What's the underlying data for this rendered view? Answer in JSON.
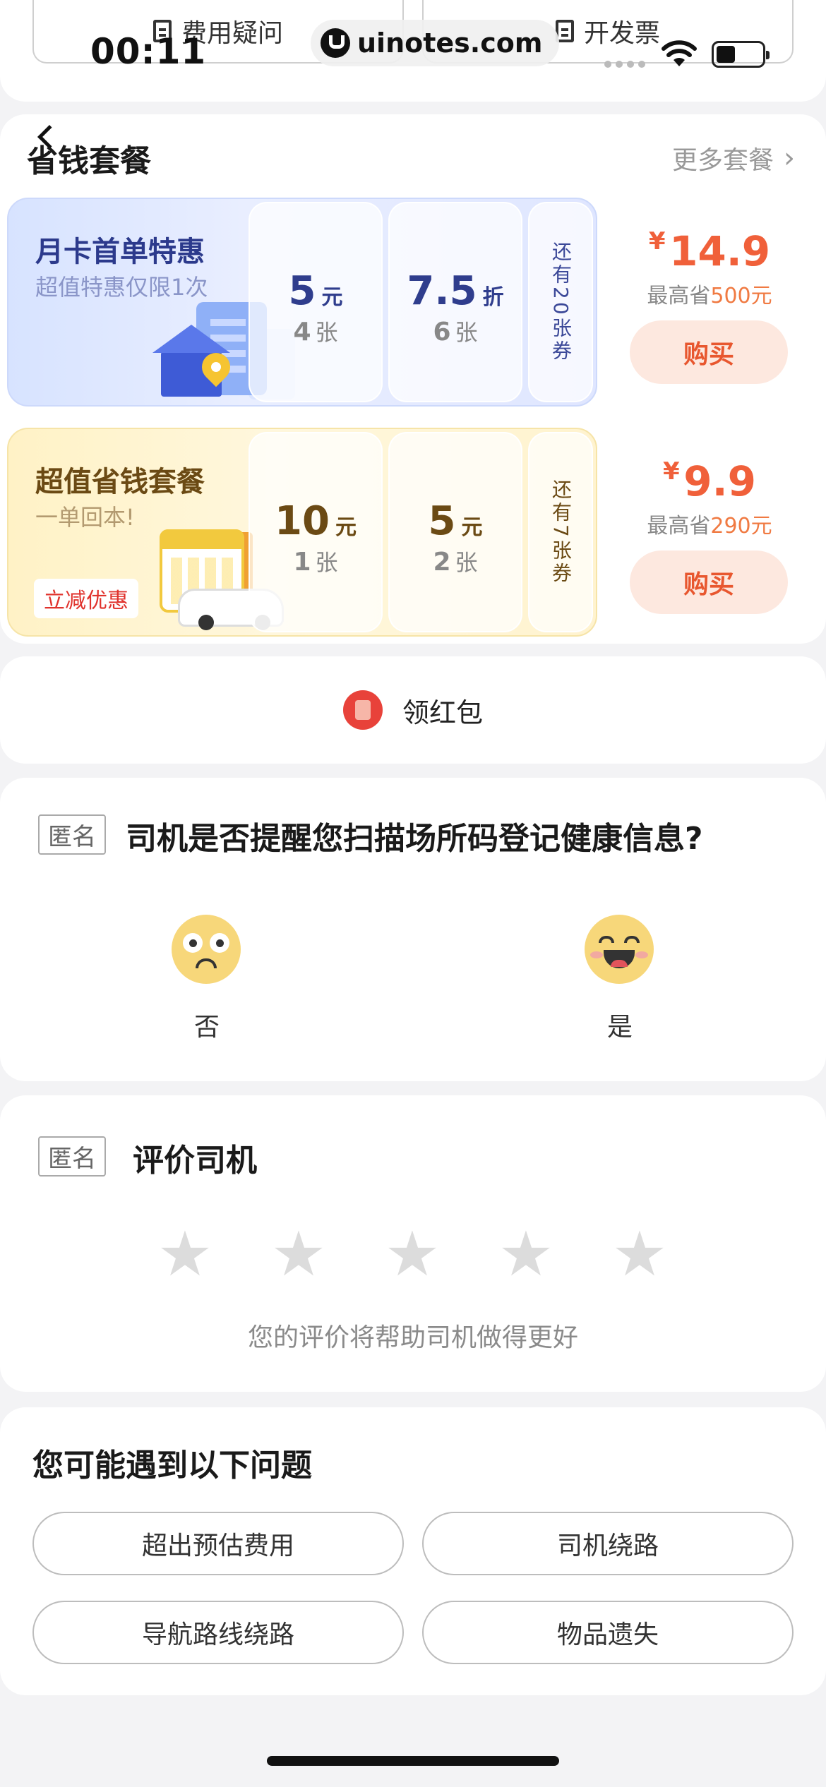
{
  "top": {
    "buttons": [
      "费用疑问",
      "开发票"
    ],
    "time": "00:11",
    "watermark": "uinotes.com"
  },
  "packages": {
    "title": "省钱套餐",
    "more": "更多套餐",
    "items": [
      {
        "title": "月卡首单特惠",
        "subtitle": "超值特惠仅限1次",
        "tag": "",
        "coupons": [
          {
            "value": "5",
            "unit": "元",
            "count": "4",
            "count_unit": "张"
          },
          {
            "value": "7.5",
            "unit": "折",
            "count": "6",
            "count_unit": "张"
          }
        ],
        "remaining": "还有20张券",
        "currency": "¥",
        "price": "14.9",
        "save_prefix": "最高省",
        "save_amount": "500元",
        "buy": "购买"
      },
      {
        "title": "超值省钱套餐",
        "subtitle": "一单回本!",
        "tag": "立减优惠",
        "coupons": [
          {
            "value": "10",
            "unit": "元",
            "count": "1",
            "count_unit": "张"
          },
          {
            "value": "5",
            "unit": "元",
            "count": "2",
            "count_unit": "张"
          }
        ],
        "remaining": "还有7张券",
        "currency": "¥",
        "price": "9.9",
        "save_prefix": "最高省",
        "save_amount": "290元",
        "buy": "购买"
      }
    ]
  },
  "red_packet": {
    "label": "领红包"
  },
  "survey": {
    "anonymous": "匿名",
    "question": "司机是否提醒您扫描场所码登记健康信息?",
    "options": [
      "否",
      "是"
    ]
  },
  "rating": {
    "anonymous": "匿名",
    "title": "评价司机",
    "stars": 5,
    "selected": 0,
    "hint": "您的评价将帮助司机做得更好"
  },
  "issues": {
    "title": "您可能遇到以下问题",
    "items": [
      "超出预估费用",
      "司机绕路",
      "导航路线绕路",
      "物品遗失"
    ]
  },
  "colors": {
    "accent_orange": "#f0603a",
    "buy_bg": "#fde8df",
    "blue_card": "#d7e3ff",
    "yellow_card": "#fff2c6"
  }
}
